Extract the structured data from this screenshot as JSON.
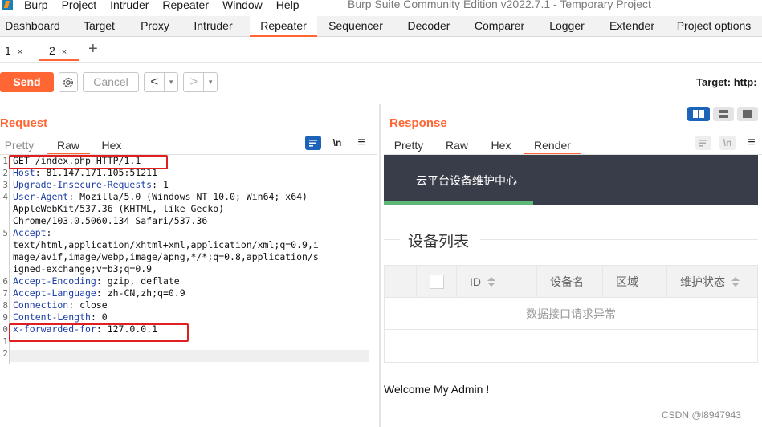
{
  "menubar": {
    "items": [
      "Burp",
      "Project",
      "Intruder",
      "Repeater",
      "Window",
      "Help"
    ],
    "window_title": "Burp Suite Community Edition v2022.7.1 - Temporary Project"
  },
  "main_tabs": [
    "Dashboard",
    "Target",
    "Proxy",
    "Intruder",
    "Repeater",
    "Sequencer",
    "Decoder",
    "Comparer",
    "Logger",
    "Extender",
    "Project options"
  ],
  "repeater_tabs": [
    {
      "label": "1",
      "close": "×"
    },
    {
      "label": "2",
      "close": "×"
    }
  ],
  "add_tab": "+",
  "toolbar": {
    "send": "Send",
    "cancel": "Cancel",
    "back": "<",
    "forward": ">",
    "dropdown": "▾",
    "target": "Target: http:"
  },
  "request": {
    "title": "Request",
    "tabs": [
      "Pretty",
      "Raw",
      "Hex"
    ],
    "newline_toggle": "\\n",
    "menu": "≡",
    "lines": [
      {
        "n": "1",
        "name": "",
        "value": "GET /index.php HTTP/1.1"
      },
      {
        "n": "2",
        "name": "Host",
        "value": ": 81.147.171.105:51211"
      },
      {
        "n": "3",
        "name": "Upgrade-Insecure-Requests",
        "value": ": 1"
      },
      {
        "n": "4",
        "name": "User-Agent",
        "value": ": Mozilla/5.0 (Windows NT 10.0; Win64; x64)"
      },
      {
        "n": "",
        "name": "",
        "value": "AppleWebKit/537.36 (KHTML, like Gecko)"
      },
      {
        "n": "",
        "name": "",
        "value": "Chrome/103.0.5060.134 Safari/537.36"
      },
      {
        "n": "5",
        "name": "Accept",
        "value": ":"
      },
      {
        "n": "",
        "name": "",
        "value": "text/html,application/xhtml+xml,application/xml;q=0.9,i"
      },
      {
        "n": "",
        "name": "",
        "value": "mage/avif,image/webp,image/apng,*/*;q=0.8,application/s"
      },
      {
        "n": "",
        "name": "",
        "value": "igned-exchange;v=b3;q=0.9"
      },
      {
        "n": "6",
        "name": "Accept-Encoding",
        "value": ": gzip, deflate"
      },
      {
        "n": "7",
        "name": "Accept-Language",
        "value": ": zh-CN,zh;q=0.9"
      },
      {
        "n": "8",
        "name": "Connection",
        "value": ": close"
      },
      {
        "n": "9",
        "name": "Content-Length",
        "value": ": 0"
      },
      {
        "n": "0",
        "name": "x-forwarded-for",
        "value": ": 127.0.0.1"
      },
      {
        "n": "1",
        "name": "",
        "value": ""
      },
      {
        "n": "2",
        "name": "",
        "value": ""
      }
    ]
  },
  "response": {
    "title": "Response",
    "tabs": [
      "Pretty",
      "Raw",
      "Hex",
      "Render"
    ],
    "newline_toggle": "\\n",
    "menu": "≡",
    "render": {
      "header_title": "云平台设备维护中心",
      "section_title": "设备列表",
      "columns": [
        "ID",
        "设备名",
        "区域",
        "维护状态"
      ],
      "empty_message": "数据接口请求异常",
      "welcome": "Welcome My Admin !"
    }
  },
  "watermark": "CSDN @l8947943",
  "colors": {
    "accent": "#ff6633",
    "header_dark": "#393d49",
    "header_underline": "#5fb878",
    "highlight_box": "#e02020",
    "layout_active": "#1b64b8"
  }
}
